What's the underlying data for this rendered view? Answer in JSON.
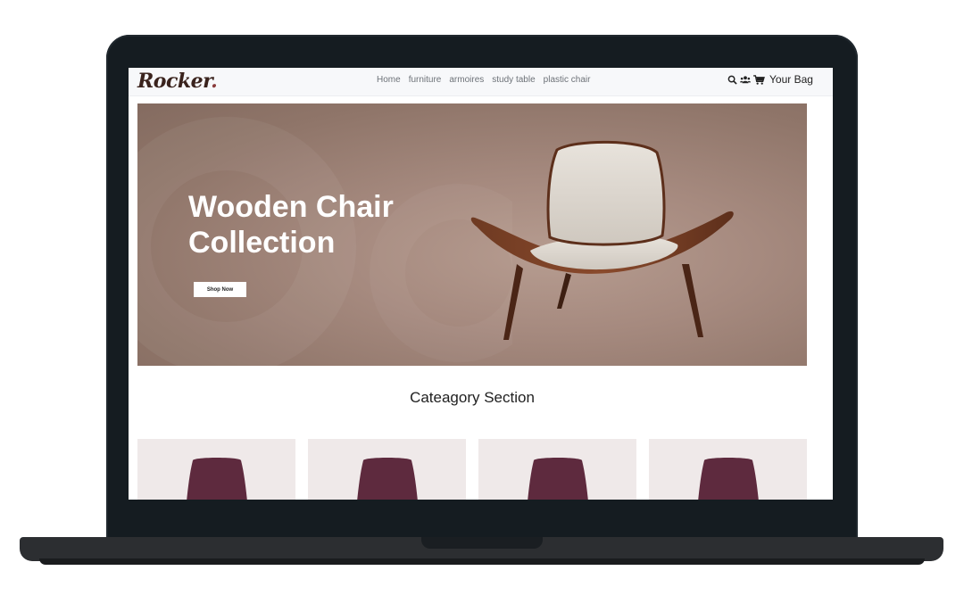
{
  "brand": {
    "name": "Rocker",
    "dot": "."
  },
  "nav": {
    "links": [
      "Home",
      "furniture",
      "armoires",
      "study table",
      "plastic chair"
    ],
    "bag_label": "Your Bag",
    "icons": [
      "search-icon",
      "users-icon",
      "cart-icon"
    ]
  },
  "hero": {
    "title": "Wooden Chair Collection",
    "button_label": "Shop Now"
  },
  "category": {
    "title": "Cateagory Section",
    "cards": 4
  },
  "colors": {
    "hero_bg": "#a68a7f",
    "card_bg": "#efe9e9",
    "chair_accent": "#5e2a3e",
    "frame": "#151c21"
  }
}
